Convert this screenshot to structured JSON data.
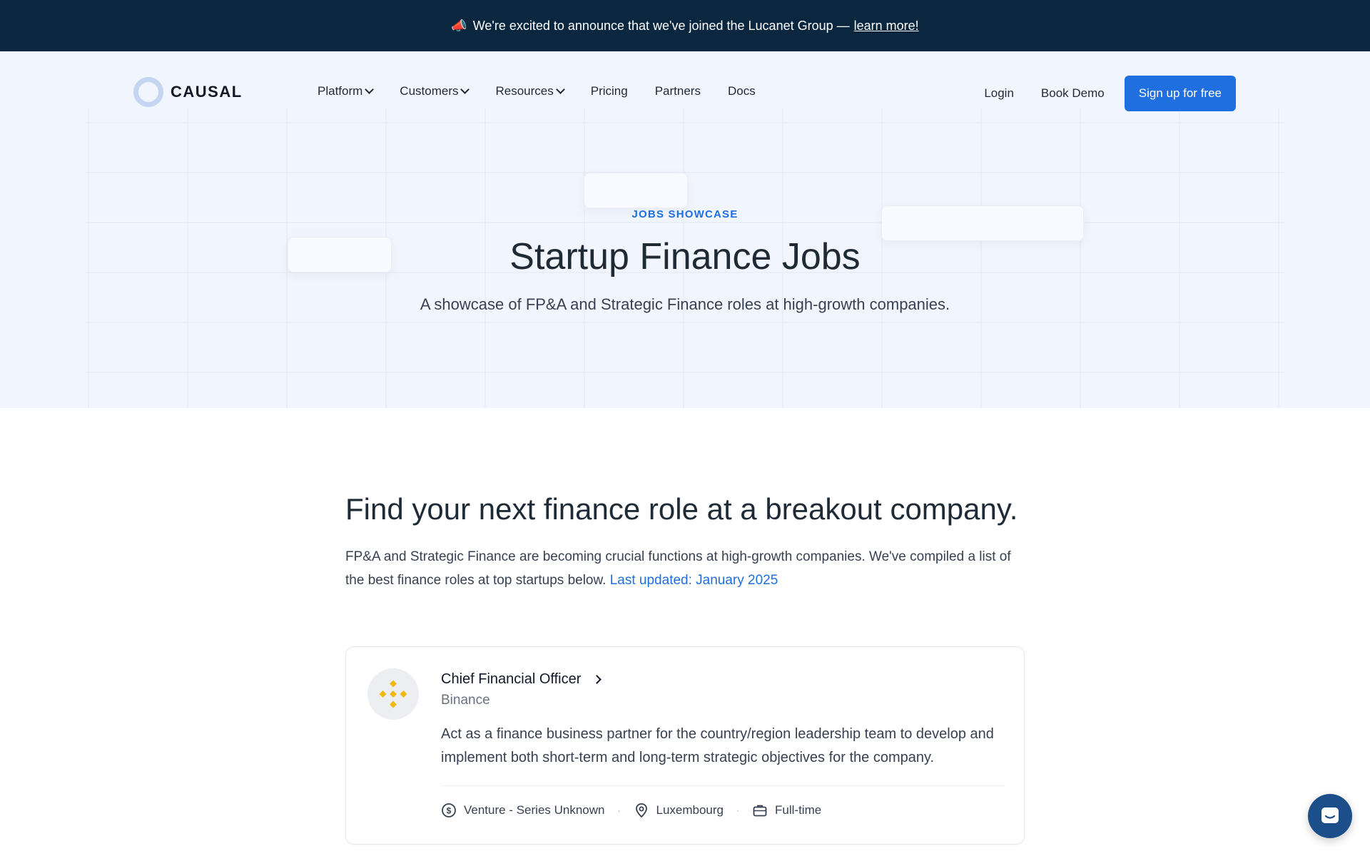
{
  "announcement": {
    "emoji": "📣",
    "text": "We're excited to announce that we've joined the Lucanet Group —",
    "link": "learn more!"
  },
  "nav": {
    "logo": "CAUSAL",
    "menu": [
      {
        "label": "Platform",
        "dropdown": true
      },
      {
        "label": "Customers",
        "dropdown": true
      },
      {
        "label": "Resources",
        "dropdown": true
      },
      {
        "label": "Pricing",
        "dropdown": false
      },
      {
        "label": "Partners",
        "dropdown": false
      },
      {
        "label": "Docs",
        "dropdown": false
      }
    ],
    "login": "Login",
    "book_demo": "Book Demo",
    "signup": "Sign up for free"
  },
  "hero": {
    "eyebrow": "JOBS SHOWCASE",
    "title": "Startup Finance Jobs",
    "subtitle": "A showcase of FP&A and Strategic Finance roles at high-growth companies."
  },
  "main": {
    "heading": "Find your next finance role at a breakout company.",
    "intro": "FP&A and Strategic Finance are becoming crucial functions at high-growth companies. We've compiled a list of the best finance roles at top startups below.",
    "updated": "Last updated: January 2025"
  },
  "jobs": [
    {
      "title": "Chief Financial Officer",
      "company": "Binance",
      "description": "Act as a finance business partner for the country/region leadership team to develop and implement both short-term and long-term strategic objectives for the company.",
      "funding": "Venture - Series Unknown",
      "location": "Luxembourg",
      "type": "Full-time",
      "logo_icon": "binance-icon"
    }
  ],
  "colors": {
    "accent": "#1f6fe0",
    "announcement_bg": "#0b2740",
    "hero_bg": "#f1f5fd",
    "binance": "#f0b90b"
  }
}
